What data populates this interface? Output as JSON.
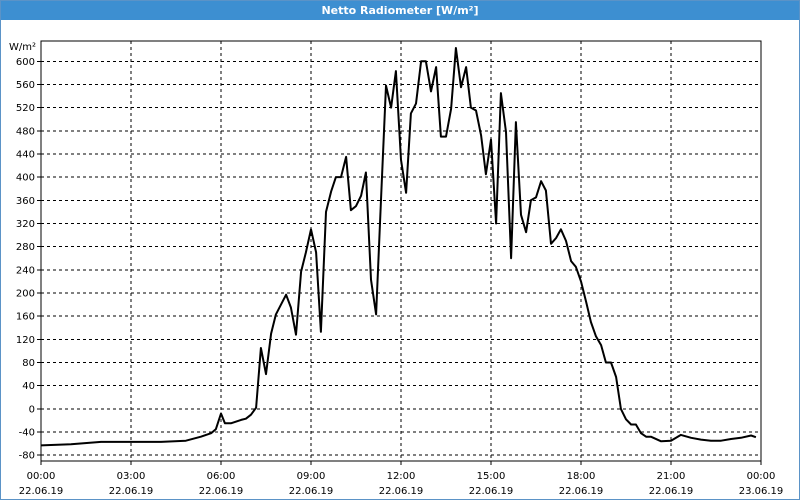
{
  "window": {
    "title": "Netto Radiometer [W/m²]"
  },
  "chart_data": {
    "type": "line",
    "title": "Netto Radiometer [W/m²]",
    "ylabel": "W/m²",
    "xlabel": "",
    "ylim": [
      -90,
      635
    ],
    "xlim_hours": [
      0,
      24
    ],
    "grid": true,
    "line_color": "#000000",
    "yticks": [
      600,
      560,
      520,
      480,
      440,
      400,
      360,
      320,
      280,
      240,
      200,
      160,
      120,
      80,
      40,
      0,
      -40,
      -80
    ],
    "xticks": [
      {
        "time": "00:00",
        "date": "22.06.19"
      },
      {
        "time": "03:00",
        "date": "22.06.19"
      },
      {
        "time": "06:00",
        "date": "22.06.19"
      },
      {
        "time": "09:00",
        "date": "22.06.19"
      },
      {
        "time": "12:00",
        "date": "22.06.19"
      },
      {
        "time": "15:00",
        "date": "22.06.19"
      },
      {
        "time": "18:00",
        "date": "22.06.19"
      },
      {
        "time": "21:00",
        "date": "22.06.19"
      },
      {
        "time": "00:00",
        "date": "23.06.19"
      }
    ],
    "series": [
      {
        "x_hours": [
          0,
          1,
          2,
          3,
          4,
          4.83,
          5.33,
          5.67,
          5.83,
          6.0,
          6.13,
          6.33,
          6.67,
          6.83,
          7.0,
          7.17,
          7.33,
          7.5,
          7.67,
          7.83,
          8.0,
          8.17,
          8.33,
          8.5,
          8.67,
          8.83,
          9.0,
          9.17,
          9.33,
          9.5,
          9.67,
          9.83,
          10.0,
          10.17,
          10.33,
          10.5,
          10.67,
          10.83,
          11.0,
          11.17,
          11.33,
          11.5,
          11.67,
          11.83,
          12.0,
          12.17,
          12.33,
          12.5,
          12.67,
          12.83,
          13.0,
          13.17,
          13.33,
          13.5,
          13.67,
          13.83,
          14.0,
          14.17,
          14.33,
          14.5,
          14.67,
          14.83,
          15.0,
          15.17,
          15.33,
          15.5,
          15.67,
          15.83,
          16.0,
          16.17,
          16.33,
          16.5,
          16.67,
          16.83,
          17.0,
          17.17,
          17.33,
          17.5,
          17.67,
          17.83,
          18.0,
          18.17,
          18.33,
          18.5,
          18.67,
          18.83,
          19.0,
          19.17,
          19.33,
          19.5,
          19.67,
          19.83,
          20.0,
          20.17,
          20.33,
          20.67,
          21.0,
          21.33,
          21.67,
          22.0,
          22.33,
          22.67,
          23.0,
          23.33,
          23.67,
          23.83
        ],
        "y": [
          -63,
          -61,
          -57,
          -57,
          -57,
          -55,
          -48,
          -42,
          -35,
          -8,
          -25,
          -25,
          -19,
          -17,
          -10,
          2,
          105,
          60,
          130,
          163,
          180,
          197,
          175,
          128,
          237,
          270,
          310,
          270,
          133,
          340,
          375,
          400,
          400,
          435,
          343,
          350,
          368,
          408,
          223,
          163,
          357,
          558,
          520,
          583,
          430,
          373,
          510,
          527,
          600,
          600,
          548,
          590,
          470,
          470,
          518,
          623,
          555,
          590,
          520,
          515,
          472,
          405,
          465,
          320,
          545,
          478,
          260,
          495,
          335,
          305,
          360,
          365,
          393,
          377,
          285,
          295,
          310,
          290,
          255,
          245,
          220,
          185,
          150,
          125,
          110,
          80,
          80,
          55,
          0,
          -18,
          -27,
          -27,
          -42,
          -48,
          -48,
          -56,
          -55,
          -45,
          -50,
          -53,
          -55,
          -55,
          -52,
          -50,
          -46,
          -49
        ]
      }
    ]
  }
}
